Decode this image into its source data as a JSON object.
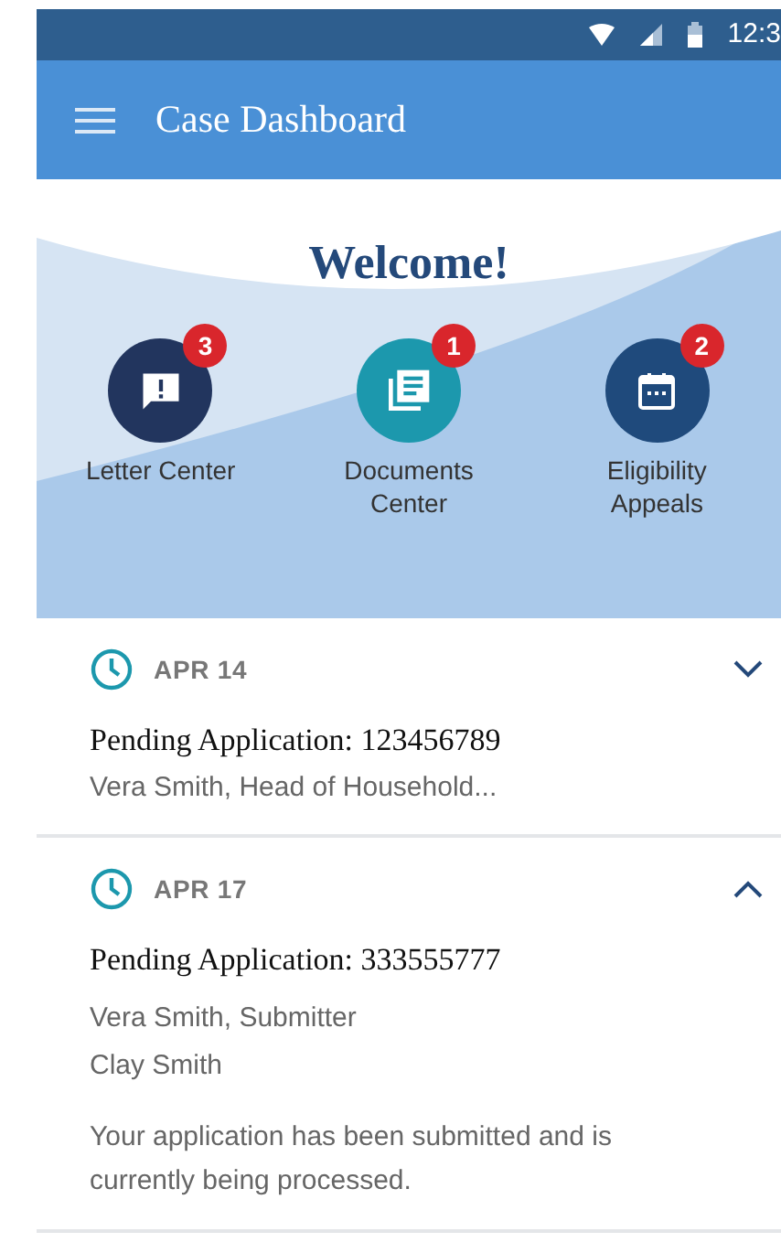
{
  "status_bar": {
    "time": "12:3"
  },
  "app_bar": {
    "title": "Case Dashboard"
  },
  "hero": {
    "title": "Welcome!",
    "tiles": [
      {
        "kind": "letters",
        "label": "Letter Center",
        "badge": "3",
        "color": "#22355e"
      },
      {
        "kind": "documents",
        "label": "Documents Center",
        "badge": "1",
        "color": "#1c98ad"
      },
      {
        "kind": "appeals",
        "label": "Eligibility Appeals",
        "badge": "2",
        "color": "#1f4a7c"
      }
    ]
  },
  "cases": [
    {
      "date": "APR 14",
      "title": "Pending Application: 123456789",
      "expanded": false,
      "summary": "Vera Smith, Head of Household..."
    },
    {
      "date": "APR 17",
      "title": "Pending Application: 333555777",
      "expanded": true,
      "people": [
        "Vera Smith, Submitter",
        "Clay Smith"
      ],
      "message": "Your application has been submitted and is currently being processed."
    }
  ]
}
